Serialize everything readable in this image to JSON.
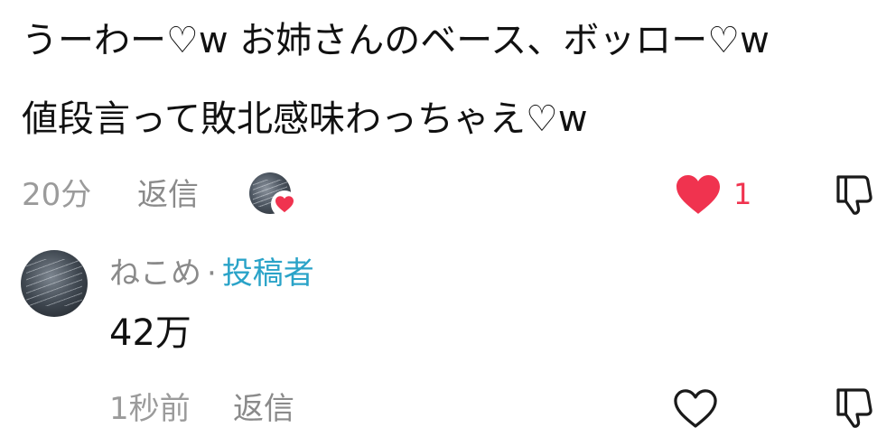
{
  "comment": {
    "line1": "うーわー♡w お姉さんのベース、ボッロー♡w",
    "line2": "値段言って敗北感味わっちゃえ♡w",
    "time": "20分",
    "reply_label": "返信",
    "like_count": "1",
    "liked": true,
    "icons": {
      "creator_liked": "heart-icon",
      "like": "heart-filled-icon",
      "dislike": "thumbs-down-icon"
    }
  },
  "reply": {
    "username": "ねこめ",
    "separator": "·",
    "author_badge": "投稿者",
    "text": "42万",
    "time": "1秒前",
    "reply_label": "返信",
    "liked": false,
    "icons": {
      "like": "heart-outline-icon",
      "dislike": "thumbs-down-icon"
    }
  },
  "colors": {
    "like_red": "#f0334f",
    "author_blue": "#2aa3c8",
    "meta_gray": "#9b9b9b"
  }
}
